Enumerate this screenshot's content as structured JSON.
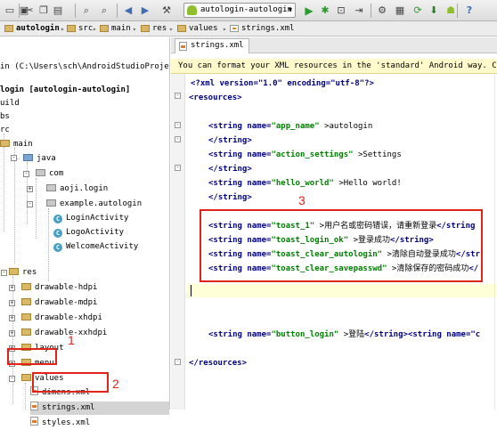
{
  "toolbar": {
    "run_config": "autologin-autologin",
    "icons": [
      "folder-open-icon",
      "save-icon",
      "sync-icon",
      "cut-icon",
      "copy-icon",
      "paste-icon",
      "find-icon",
      "replace-icon",
      "back-icon",
      "forward-icon",
      "build-icon",
      "run-icon",
      "debug-icon",
      "attach-icon",
      "sdk-manager-icon",
      "avd-icon",
      "android-icon",
      "help-icon"
    ]
  },
  "navbar": {
    "crumbs": [
      "autologin",
      "src",
      "main",
      "res",
      "values",
      "strings.xml"
    ]
  },
  "project": {
    "path": "in (C:\\Users\\sch\\AndroidStudioProje",
    "module_label": "login [autologin-autologin]",
    "items": [
      {
        "label": "uild"
      },
      {
        "label": "bs"
      },
      {
        "label": "rc"
      },
      {
        "label": "main"
      },
      {
        "label": "java"
      },
      {
        "label": "com"
      },
      {
        "label": "aoji.login"
      },
      {
        "label": "example.autologin"
      },
      {
        "label": "LoginActivity"
      },
      {
        "label": "LogoActivity"
      },
      {
        "label": "WelcomeActivity"
      },
      {
        "label": "res"
      },
      {
        "label": "drawable-hdpi"
      },
      {
        "label": "drawable-mdpi"
      },
      {
        "label": "drawable-xhdpi"
      },
      {
        "label": "drawable-xxhdpi"
      },
      {
        "label": "layout"
      },
      {
        "label": "menu"
      },
      {
        "label": "values"
      },
      {
        "label": "dimens.xml"
      },
      {
        "label": "strings.xml"
      },
      {
        "label": "styles.xml"
      }
    ]
  },
  "editor": {
    "tab": "strings.xml",
    "banner": "You can format your XML resources in the 'standard' Android way. Choose",
    "lines": {
      "decl": "<?xml version=\"1.0\" encoding=\"utf-8\"?>",
      "res_open": "<resources>",
      "s1_open": "<string name=",
      "s1_name": "\"app_name\"",
      "s1_text": ">autologin",
      "s1_close": "</string>",
      "s2_open": "<string name=",
      "s2_name": "\"action_settings\"",
      "s2_text": ">Settings",
      "s2_close": "</string>",
      "s3_open": "<string name=",
      "s3_name": "\"hello_world\"",
      "s3_text": ">Hello world!",
      "s3_close": "</string>",
      "t1_open": "<string name=",
      "t1_name": "\"toast_1\"",
      "t1_text": ">用户名或密码错误，请重新登录",
      "t1_close": "</string",
      "t2_open": "<string name=",
      "t2_name": "\"toast_login_ok\"",
      "t2_text": ">登录成功",
      "t2_close": "</string>",
      "t3_open": "<string name=",
      "t3_name": "\"toast_clear_autologin\"",
      "t3_text": ">清除自动登录成功",
      "t3_close": "</str",
      "t4_open": "<string name=",
      "t4_name": "\"toast_clear_savepasswd\"",
      "t4_text": ">清除保存的密码成功",
      "t4_close": "</",
      "b_open": "<string name=",
      "b_name": "\"button_login\"",
      "b_text": ">登陆",
      "b_close": "</string>",
      "b_tail": "<string name=\"c",
      "res_close": "</resources>"
    }
  },
  "annotations": {
    "label_1": "1",
    "label_2": "2",
    "label_3": "3",
    "color": "#e2231a"
  }
}
